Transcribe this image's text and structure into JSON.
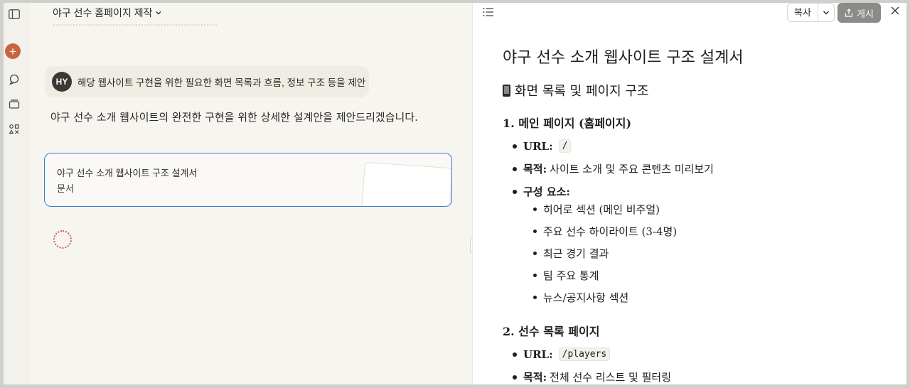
{
  "chat": {
    "title": "야구 선수 홈페이지 제작",
    "user_initials": "HY",
    "user_message": "해당 웹사이트 구현을 위한 필요한 화면 목록과 흐름, 정보 구조 등을 제안",
    "assistant_message": "야구 선수 소개 웹사이트의 완전한 구현을 위한 상세한 설계안을 제안드리겠습니다.",
    "artifact": {
      "title": "야구 선수 소개 웹사이트 구조 설계서",
      "type": "문서"
    }
  },
  "toolbar": {
    "copy_label": "복사",
    "publish_label": "게시"
  },
  "document": {
    "title": "야구 선수 소개 웹사이트 구조 설계서",
    "section_heading": "화면 목록 및 페이지 구조",
    "pages": [
      {
        "heading": "1. 메인 페이지 (홈페이지)",
        "url_label": "URL:",
        "url": "/",
        "purpose_label": "목적:",
        "purpose": "사이트 소개 및 주요 콘텐츠 미리보기",
        "components_label": "구성 요소:",
        "components": [
          "히어로 섹션 (메인 비주얼)",
          "주요 선수 하이라이트 (3-4명)",
          "최근 경기 결과",
          "팀 주요 통계",
          "뉴스/공지사항 섹션"
        ]
      },
      {
        "heading": "2. 선수 목록 페이지",
        "url_label": "URL:",
        "url": "/players",
        "purpose_label": "목적:",
        "purpose": "전체 선수 리스트 및 필터링"
      }
    ]
  },
  "colors": {
    "accent": "#c96442",
    "card_border": "#3b7fd0",
    "publish_bg": "#8c8b87"
  }
}
